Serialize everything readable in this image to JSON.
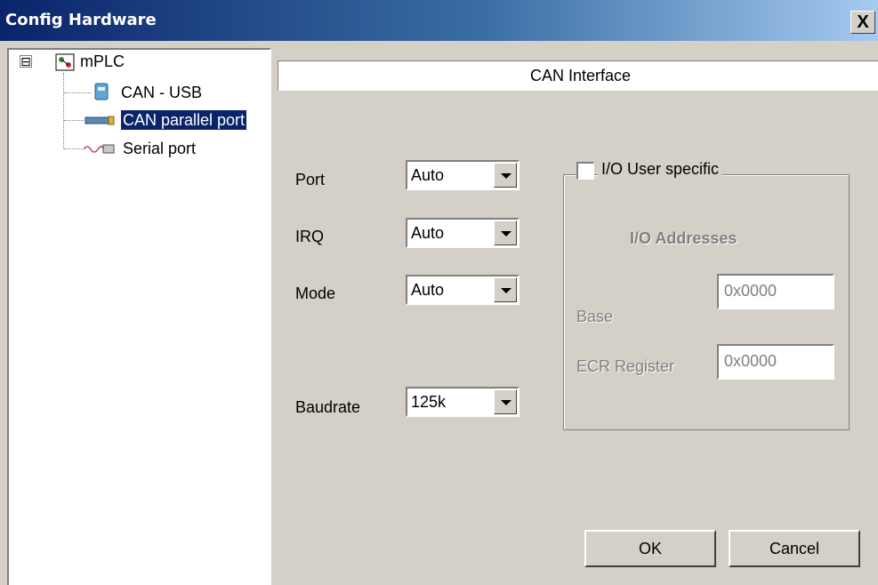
{
  "window": {
    "title": "Config Hardware",
    "close_label": "X"
  },
  "tree": {
    "root": {
      "label": "mPLC",
      "expander": "⊟",
      "icon": "network-icon"
    },
    "items": [
      {
        "label": "CAN - USB",
        "icon": "usb-device-icon",
        "selected": false
      },
      {
        "label": "CAN parallel port",
        "icon": "parallel-port-icon",
        "selected": true
      },
      {
        "label": "Serial port",
        "icon": "serial-port-icon",
        "selected": false
      }
    ]
  },
  "panel": {
    "header": "CAN Interface",
    "fields": [
      {
        "label": "Port",
        "value": "Auto"
      },
      {
        "label": "IRQ",
        "value": "Auto"
      },
      {
        "label": "Mode",
        "value": "Auto"
      },
      {
        "label": "Baudrate",
        "value": "125k"
      }
    ],
    "io_group": {
      "checkbox_label": "I/O User specific",
      "checked": false,
      "title": "I/O Addresses",
      "base_label": "Base",
      "base_value": "0x0000",
      "ecr_label": "ECR Register",
      "ecr_value": "0x0000"
    }
  },
  "buttons": {
    "ok": "OK",
    "cancel": "Cancel"
  },
  "colors": {
    "title_start": "#0a246a",
    "title_end": "#a6caf0",
    "selection": "#0a246a",
    "face": "#d4d0c8"
  }
}
